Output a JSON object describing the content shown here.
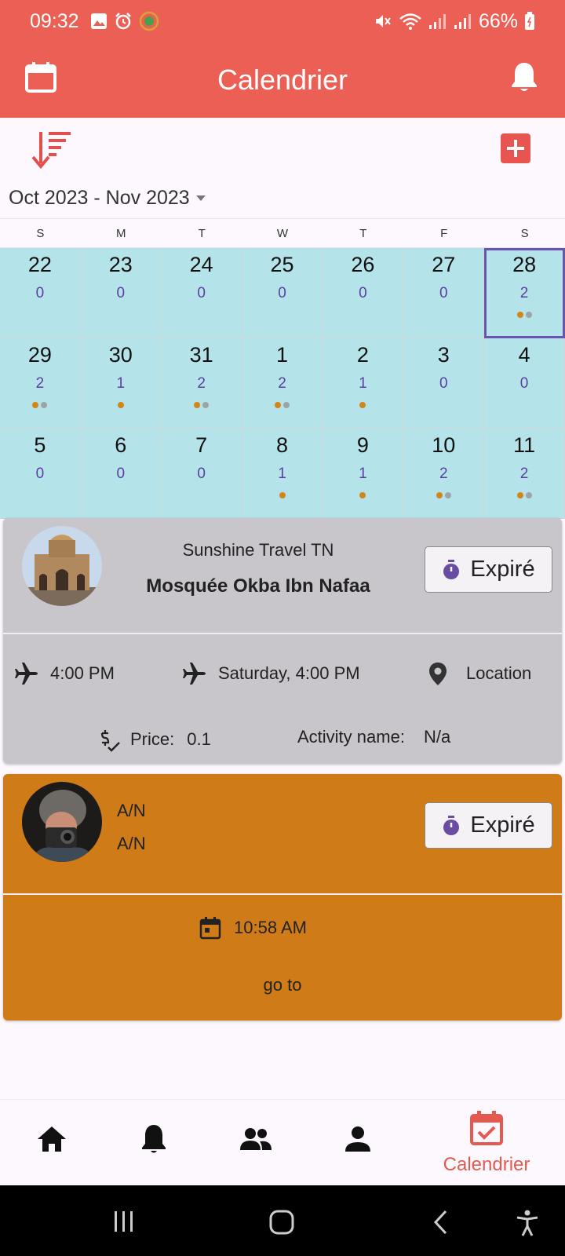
{
  "status_bar": {
    "time": "09:32",
    "battery": "66%"
  },
  "app_bar": {
    "title": "Calendrier"
  },
  "calendar": {
    "range_label": "Oct 2023 - Nov 2023",
    "weekdays": [
      "S",
      "M",
      "T",
      "W",
      "T",
      "F",
      "S"
    ],
    "weeks": [
      [
        {
          "day": "22",
          "count": "0",
          "dots": []
        },
        {
          "day": "23",
          "count": "0",
          "dots": []
        },
        {
          "day": "24",
          "count": "0",
          "dots": []
        },
        {
          "day": "25",
          "count": "0",
          "dots": []
        },
        {
          "day": "26",
          "count": "0",
          "dots": []
        },
        {
          "day": "27",
          "count": "0",
          "dots": []
        },
        {
          "day": "28",
          "count": "2",
          "dots": [
            "orange",
            "gray"
          ],
          "selected": true
        }
      ],
      [
        {
          "day": "29",
          "count": "2",
          "dots": [
            "orange",
            "gray"
          ]
        },
        {
          "day": "30",
          "count": "1",
          "dots": [
            "orange"
          ]
        },
        {
          "day": "31",
          "count": "2",
          "dots": [
            "orange",
            "gray"
          ]
        },
        {
          "day": "1",
          "count": "2",
          "dots": [
            "orange",
            "gray"
          ]
        },
        {
          "day": "2",
          "count": "1",
          "dots": [
            "orange"
          ]
        },
        {
          "day": "3",
          "count": "0",
          "dots": []
        },
        {
          "day": "4",
          "count": "0",
          "dots": []
        }
      ],
      [
        {
          "day": "5",
          "count": "0",
          "dots": []
        },
        {
          "day": "6",
          "count": "0",
          "dots": []
        },
        {
          "day": "7",
          "count": "0",
          "dots": []
        },
        {
          "day": "8",
          "count": "1",
          "dots": [
            "orange"
          ]
        },
        {
          "day": "9",
          "count": "1",
          "dots": [
            "orange"
          ]
        },
        {
          "day": "10",
          "count": "2",
          "dots": [
            "orange",
            "gray"
          ]
        },
        {
          "day": "11",
          "count": "2",
          "dots": [
            "orange",
            "gray"
          ]
        }
      ]
    ]
  },
  "cards": {
    "card1": {
      "agency": "Sunshine Travel TN",
      "name": "Mosquée Okba Ibn Nafaa",
      "status": "Expiré",
      "depart_time": "4:00 PM",
      "arrive_time": "Saturday, 4:00 PM",
      "location": "Location",
      "price_label": "Price:",
      "price_value": "0.1",
      "activity_label": "Activity name:",
      "activity_value": "N/a"
    },
    "card2": {
      "line1": "A/N",
      "line2": "A/N",
      "status": "Expiré",
      "time": "10:58 AM",
      "link": "go to"
    }
  },
  "bottom_nav": {
    "active_label": "Calendrier"
  },
  "colors": {
    "primary": "#ec5f55",
    "calendar_cell": "#b4e4ea",
    "card1_bg": "#c8c6ca",
    "card2_bg": "#cf7c18",
    "accent_purple": "#6b54ad"
  }
}
